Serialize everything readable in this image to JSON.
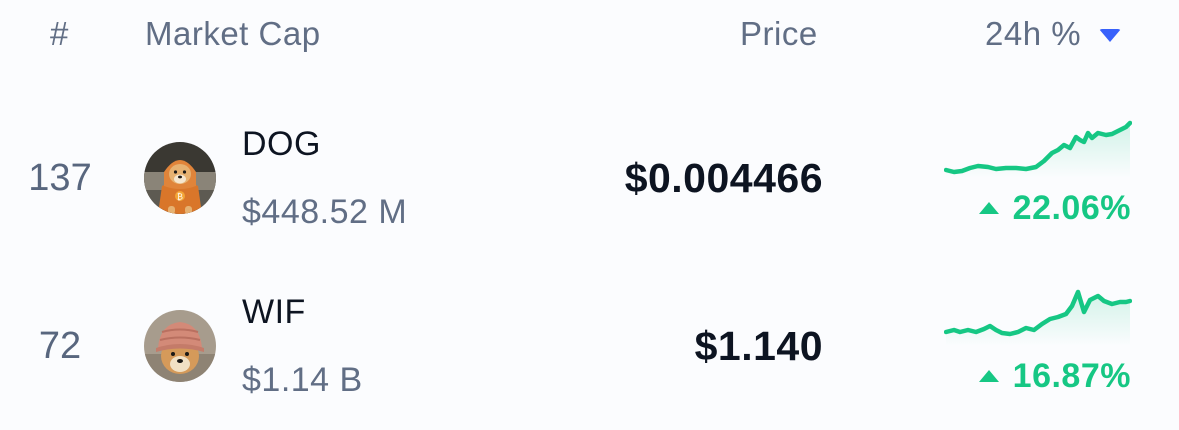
{
  "header": {
    "rank": "#",
    "market_cap": "Market Cap",
    "price": "Price",
    "change": "24h %"
  },
  "colors": {
    "accent": "#3861fb",
    "positive": "#16c784",
    "muted_text": "#616e85",
    "primary_text": "#0d1421"
  },
  "rows": [
    {
      "rank": "137",
      "symbol": "DOG",
      "market_cap": "$448.52 M",
      "price": "$0.004466",
      "change": "22.06%",
      "direction": "up",
      "avatar_icon": "shiba-dog-in-orange-hoodie-icon"
    },
    {
      "rank": "72",
      "symbol": "WIF",
      "market_cap": "$1.14 B",
      "price": "$1.140",
      "change": "16.87%",
      "direction": "up",
      "avatar_icon": "shiba-dog-in-knit-hat-icon"
    }
  ]
}
